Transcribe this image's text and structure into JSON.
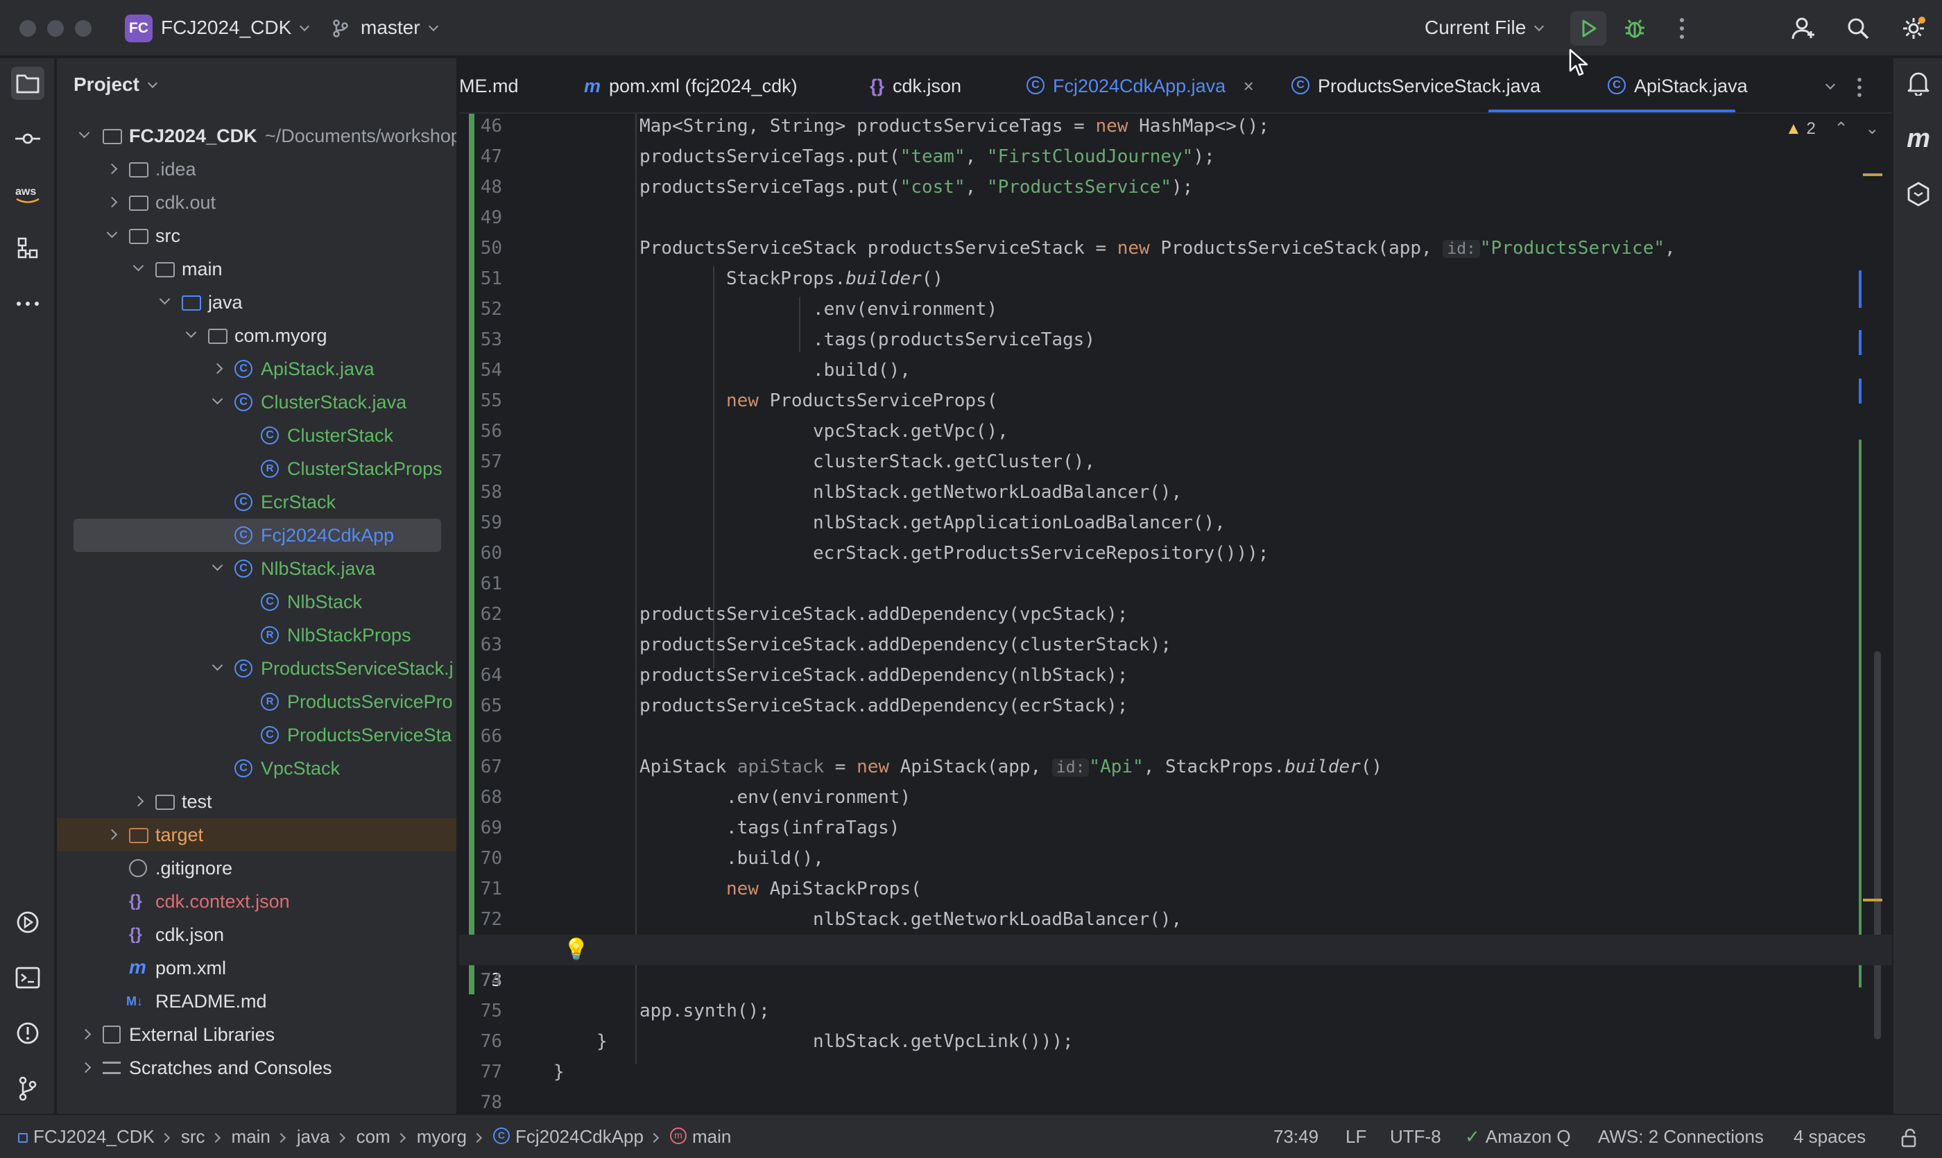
{
  "titlebar": {
    "project_badge": "FC",
    "project_name": "FCJ2024_CDK",
    "branch": "master",
    "run_config": "Current File"
  },
  "project_panel": {
    "title": "Project",
    "root_name": "FCJ2024_CDK",
    "root_path": "~/Documents/workshop",
    "items": [
      {
        "label": ".idea"
      },
      {
        "label": "cdk.out"
      },
      {
        "label": "src"
      },
      {
        "label": "main"
      },
      {
        "label": "java"
      },
      {
        "label": "com.myorg"
      },
      {
        "label": "ApiStack.java"
      },
      {
        "label": "ClusterStack.java"
      },
      {
        "label": "ClusterStack"
      },
      {
        "label": "ClusterStackProps"
      },
      {
        "label": "EcrStack"
      },
      {
        "label": "Fcj2024CdkApp"
      },
      {
        "label": "NlbStack.java"
      },
      {
        "label": "NlbStack"
      },
      {
        "label": "NlbStackProps"
      },
      {
        "label": "ProductsServiceStack.j"
      },
      {
        "label": "ProductsServicePro"
      },
      {
        "label": "ProductsServiceSta"
      },
      {
        "label": "VpcStack"
      },
      {
        "label": "test"
      },
      {
        "label": "target"
      },
      {
        "label": ".gitignore"
      },
      {
        "label": "cdk.context.json"
      },
      {
        "label": "cdk.json"
      },
      {
        "label": "pom.xml"
      },
      {
        "label": "README.md"
      },
      {
        "label": "External Libraries"
      },
      {
        "label": "Scratches and Consoles"
      }
    ]
  },
  "tabs": [
    {
      "label": "ME.md"
    },
    {
      "label": "pom.xml (fcj2024_cdk)"
    },
    {
      "label": "cdk.json"
    },
    {
      "label": "Fcj2024CdkApp.java"
    },
    {
      "label": "ProductsServiceStack.java"
    },
    {
      "label": "ApiStack.java"
    }
  ],
  "editor": {
    "warnings_count": "2",
    "lines": [
      {
        "n": "46"
      },
      {
        "n": "47"
      },
      {
        "n": "48"
      },
      {
        "n": "49"
      },
      {
        "n": "50"
      },
      {
        "n": "51"
      },
      {
        "n": "52"
      },
      {
        "n": "53"
      },
      {
        "n": "54"
      },
      {
        "n": "55"
      },
      {
        "n": "56"
      },
      {
        "n": "57"
      },
      {
        "n": "58"
      },
      {
        "n": "59"
      },
      {
        "n": "60"
      },
      {
        "n": "61"
      },
      {
        "n": "62"
      },
      {
        "n": "63"
      },
      {
        "n": "64"
      },
      {
        "n": "65"
      },
      {
        "n": "66"
      },
      {
        "n": "67"
      },
      {
        "n": "68"
      },
      {
        "n": "69"
      },
      {
        "n": "70"
      },
      {
        "n": "71"
      },
      {
        "n": "72"
      },
      {
        "n": "73"
      },
      {
        "n": "74"
      },
      {
        "n": "75"
      },
      {
        "n": "76"
      },
      {
        "n": "77"
      },
      {
        "n": "78"
      }
    ],
    "code": {
      "l46a": "Map<String, String> productsServiceTags = ",
      "l46kw": "new",
      "l46b": " HashMap<>();",
      "l47a": "productsServiceTags.put(",
      "l47s1": "\"team\"",
      "l47b": ", ",
      "l47s2": "\"FirstCloudJourney\"",
      "l47c": ");",
      "l48a": "productsServiceTags.put(",
      "l48s1": "\"cost\"",
      "l48b": ", ",
      "l48s2": "\"ProductsService\"",
      "l48c": ");",
      "l50a": "ProductsServiceStack productsServiceStack = ",
      "l50kw": "new",
      "l50b": " ProductsServiceStack(app, ",
      "l50hint": "id:",
      "l50s": "\"ProductsService\"",
      "l50c": ",",
      "l51a": "StackProps.",
      "l51i": "builder",
      "l51b": "()",
      "l52": ".env(environment)",
      "l53": ".tags(productsServiceTags)",
      "l54": ".build(),",
      "l55kw": "new",
      "l55": " ProductsServiceProps(",
      "l56": "vpcStack.getVpc(),",
      "l57": "clusterStack.getCluster(),",
      "l58": "nlbStack.getNetworkLoadBalancer(),",
      "l59": "nlbStack.getApplicationLoadBalancer(),",
      "l60": "ecrStack.getProductsServiceRepository()));",
      "l62": "productsServiceStack.addDependency(vpcStack);",
      "l63": "productsServiceStack.addDependency(clusterStack);",
      "l64": "productsServiceStack.addDependency(nlbStack);",
      "l65": "productsServiceStack.addDependency(ecrStack);",
      "l67a": "ApiStack ",
      "l67v": "apiStack",
      "l67b": " = ",
      "l67kw": "new",
      "l67c": " ApiStack(app, ",
      "l67hint": "id:",
      "l67s": "\"Api\"",
      "l67d": ", StackProps.",
      "l67i": "builder",
      "l67e": "()",
      "l68": ".env(environment)",
      "l69": ".tags(infraTags)",
      "l70": ".build(),",
      "l71kw": "new",
      "l71": " ApiStackProps(",
      "l72": "nlbStack.getNetworkLoadBalancer(),",
      "l73": "nlbStack.getVpcLink()));",
      "l75": "app.synth();",
      "l76": "}",
      "l77": "}"
    }
  },
  "statusbar": {
    "crumbs": [
      "FCJ2024_CDK",
      "src",
      "main",
      "java",
      "com",
      "myorg",
      "Fcj2024CdkApp",
      "main"
    ],
    "position": "73:49",
    "line_ending": "LF",
    "encoding": "UTF-8",
    "amazon_q": "Amazon Q",
    "aws": "AWS: 2 Connections",
    "indent": "4 spaces"
  },
  "icons": {
    "left_strip": [
      "folder-icon",
      "commit-icon",
      "aws-icon",
      "structure-icon",
      "more-icon",
      "services-icon",
      "terminal-icon",
      "problems-icon",
      "git-icon"
    ],
    "right_strip": [
      "notifications-icon",
      "maven-icon",
      "aws-toolkit-icon"
    ]
  },
  "colors": {
    "accent": "#3574f0",
    "class_blue": "#548af7",
    "vcs_green": "#5fb865",
    "keyword": "#cf8e6d",
    "string": "#6aab73",
    "ignored_red": "#e06c75"
  }
}
